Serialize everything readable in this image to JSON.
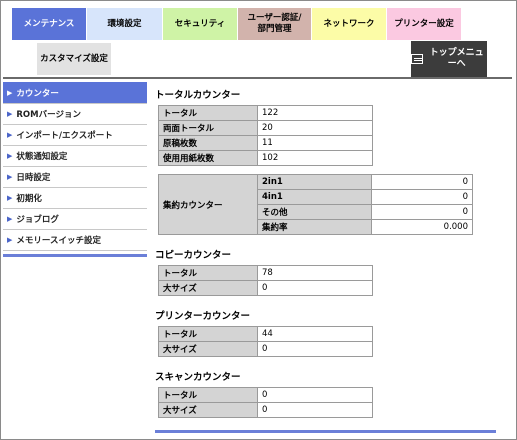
{
  "tabs": [
    {
      "label": "メンテナンス",
      "bg": "#5a73d8",
      "fg": "#ffffff"
    },
    {
      "label": "環境設定",
      "bg": "#d7e5fb",
      "fg": "#000000"
    },
    {
      "label": "セキュリティ",
      "bg": "#cff3a6",
      "fg": "#000000"
    },
    {
      "label": "ユーザー認証/部門管理",
      "bg": "#d2b3ac",
      "fg": "#000000"
    },
    {
      "label": "ネットワーク",
      "bg": "#fcfca7",
      "fg": "#000000"
    },
    {
      "label": "プリンター設定",
      "bg": "#fbc9e1",
      "fg": "#000000"
    },
    {
      "label": "カスタマイズ設定",
      "bg": "#e2e2e2",
      "fg": "#000000"
    }
  ],
  "top_menu": {
    "label": "トップメニューへ",
    "icon": "top-menu-icon"
  },
  "sidebar": {
    "items": [
      {
        "label": "カウンター",
        "active": true
      },
      {
        "label": "ROMバージョン"
      },
      {
        "label": "インポート/エクスポート"
      },
      {
        "label": "状態通知設定"
      },
      {
        "label": "日時設定"
      },
      {
        "label": "初期化"
      },
      {
        "label": "ジョブログ"
      },
      {
        "label": "メモリースイッチ設定"
      }
    ]
  },
  "total_counter": {
    "title": "トータルカウンター",
    "rows": [
      {
        "label": "トータル",
        "value": "122"
      },
      {
        "label": "両面トータル",
        "value": "20"
      },
      {
        "label": "原稿枚数",
        "value": "11"
      },
      {
        "label": "使用用紙枚数",
        "value": "102"
      }
    ],
    "aggregate": {
      "label": "集約カウンター",
      "rows": [
        {
          "label": "2in1",
          "value": "0"
        },
        {
          "label": "4in1",
          "value": "0"
        },
        {
          "label": "その他",
          "value": "0"
        },
        {
          "label": "集約率",
          "value": "0.000"
        }
      ]
    }
  },
  "copy_counter": {
    "title": "コピーカウンター",
    "rows": [
      {
        "label": "トータル",
        "value": "78"
      },
      {
        "label": "大サイズ",
        "value": "0"
      }
    ]
  },
  "printer_counter": {
    "title": "プリンターカウンター",
    "rows": [
      {
        "label": "トータル",
        "value": "44"
      },
      {
        "label": "大サイズ",
        "value": "0"
      }
    ]
  },
  "scan_counter": {
    "title": "スキャンカウンター",
    "rows": [
      {
        "label": "トータル",
        "value": "0"
      },
      {
        "label": "大サイズ",
        "value": "0"
      }
    ]
  }
}
